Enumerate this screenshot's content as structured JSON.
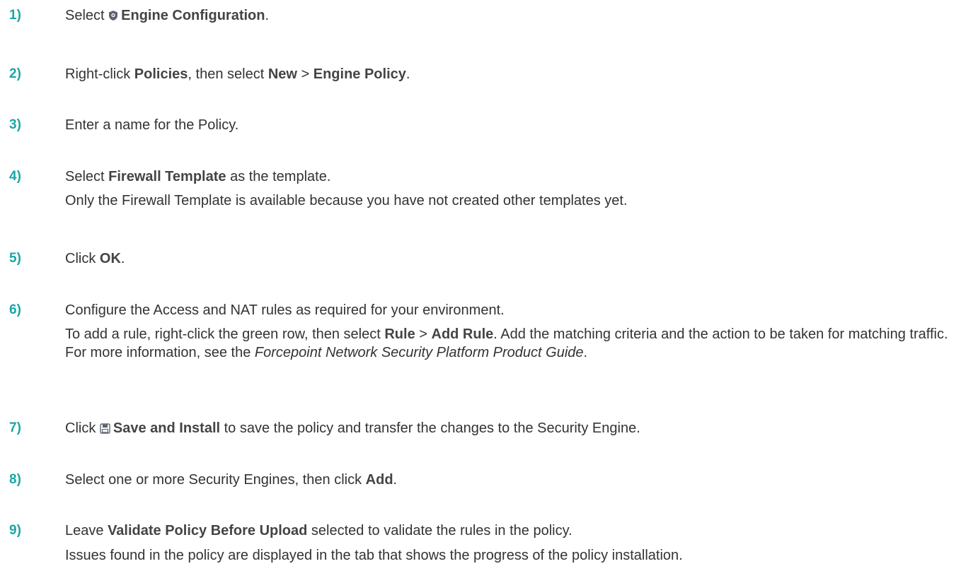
{
  "steps": [
    {
      "num": "1)",
      "l1_a": "Select ",
      "icon": "engine-configuration-shield-icon",
      "l1_b": "Engine Configuration",
      "l1_c": "."
    },
    {
      "num": "2)",
      "l1_a": "Right-click ",
      "l1_b": "Policies",
      "l1_c": ", then select ",
      "l1_d": "New",
      "l1_e": " > ",
      "l1_f": "Engine Policy",
      "l1_g": "."
    },
    {
      "num": "3)",
      "l1_a": "Enter a name for the Policy."
    },
    {
      "num": "4)",
      "l1_a": "Select ",
      "l1_b": "Firewall Template",
      "l1_c": " as the template.",
      "l2": "Only the Firewall Template is available because you have not created other templates yet."
    },
    {
      "num": "5)",
      "l1_a": "Click ",
      "l1_b": "OK",
      "l1_c": "."
    },
    {
      "num": "6)",
      "l1_a": "Configure the Access and NAT rules as required for your environment.",
      "p_a": "To add a rule, right-click the green row, then select ",
      "p_b": "Rule",
      "p_c": " > ",
      "p_d": "Add Rule",
      "p_e": ". Add the matching criteria and the action to be taken for matching traffic. For more information, see the ",
      "p_f": "Forcepoint Network Security Platform Product Guide",
      "p_g": "."
    },
    {
      "num": "7)",
      "l1_a": "Click ",
      "icon": "save-and-install-icon",
      "l1_b": "Save and Install",
      "l1_c": " to save the policy and transfer the changes to the Security Engine."
    },
    {
      "num": "8)",
      "l1_a": "Select one or more Security Engines, then click ",
      "l1_b": "Add",
      "l1_c": "."
    },
    {
      "num": "9)",
      "l1_a": "Leave ",
      "l1_b": "Validate Policy Before Upload",
      "l1_c": " selected to validate the rules in the policy.",
      "l2": "Issues found in the policy are displayed in the tab that shows the progress of the policy installation."
    }
  ]
}
